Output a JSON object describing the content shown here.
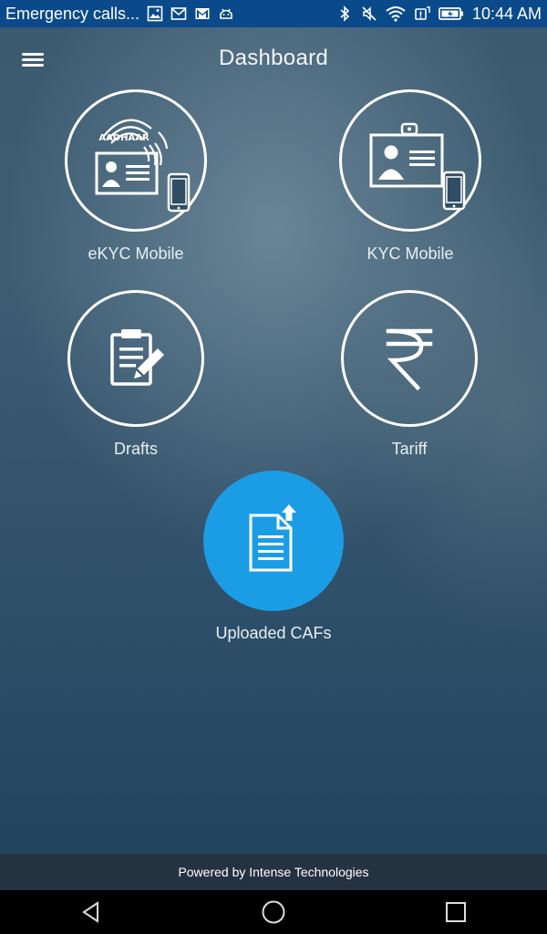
{
  "status_bar": {
    "notification_text": "Emergency calls...",
    "time": "10:44 AM",
    "left_icons": [
      "image-icon",
      "mail-icon",
      "gmail-icon",
      "android-icon"
    ],
    "right_icons": [
      "bluetooth-icon",
      "mute-icon",
      "wifi-icon",
      "alert-icon",
      "battery-icon"
    ]
  },
  "header": {
    "title": "Dashboard",
    "menu_icon": "menu-icon"
  },
  "tiles": [
    {
      "label": "eKYC Mobile",
      "icon": "aadhaar-ekyc-icon",
      "badge_text": "AADHAAR"
    },
    {
      "label": "KYC Mobile",
      "icon": "id-card-mobile-icon"
    },
    {
      "label": "Drafts",
      "icon": "clipboard-edit-icon"
    },
    {
      "label": "Tariff",
      "icon": "rupee-icon"
    },
    {
      "label": "Uploaded CAFs",
      "icon": "document-upload-icon",
      "accent": "#1b9de6"
    }
  ],
  "footer": {
    "text": "Powered by Intense Technologies"
  },
  "nav": {
    "icons": [
      "back-icon",
      "home-icon",
      "recents-icon"
    ]
  }
}
